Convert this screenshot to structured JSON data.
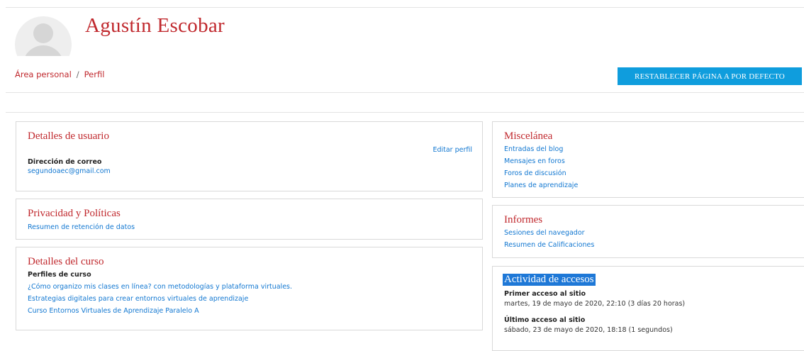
{
  "profile": {
    "name": "Agustín Escobar"
  },
  "breadcrumb": {
    "items": [
      "Área personal",
      "Perfil"
    ],
    "separator": "/"
  },
  "actions": {
    "reset_label": "RESTABLECER PÁGINA A POR DEFECTO"
  },
  "user_details": {
    "title": "Detalles de usuario",
    "edit_link": "Editar perfil",
    "email_label": "Dirección de correo",
    "email_value": "segundoaec@gmail.com"
  },
  "privacy": {
    "title": "Privacidad y Políticas",
    "links": [
      "Resumen de retención de datos"
    ]
  },
  "course_details": {
    "title": "Detalles del curso",
    "profiles_label": "Perfiles de curso",
    "courses": [
      "¿Cómo organizo mis clases en línea? con metodologías y plataforma virtuales.",
      "Estrategias digitales para crear entornos virtuales de aprendizaje",
      "Curso Entornos Virtuales de Aprendizaje Paralelo A"
    ]
  },
  "miscellany": {
    "title": "Miscelánea",
    "links": [
      "Entradas del blog",
      "Mensajes en foros",
      "Foros de discusión",
      "Planes de aprendizaje"
    ]
  },
  "reports": {
    "title": "Informes",
    "links": [
      "Sesiones del navegador",
      "Resumen de Calificaciones"
    ]
  },
  "access_activity": {
    "title": "Actividad de accesos",
    "first_access_label": "Primer acceso al sitio",
    "first_access_value": "martes, 19 de mayo de 2020, 22:10  (3 días 20 horas)",
    "last_access_label": "Último acceso al sitio",
    "last_access_value": "sábado, 23 de mayo de 2020, 18:18  (1 segundos)"
  },
  "colors": {
    "accent_red": "#c0282d",
    "link_blue": "#1177d1",
    "button_blue": "#0f9ddd",
    "selection_blue": "#1e78d7"
  }
}
